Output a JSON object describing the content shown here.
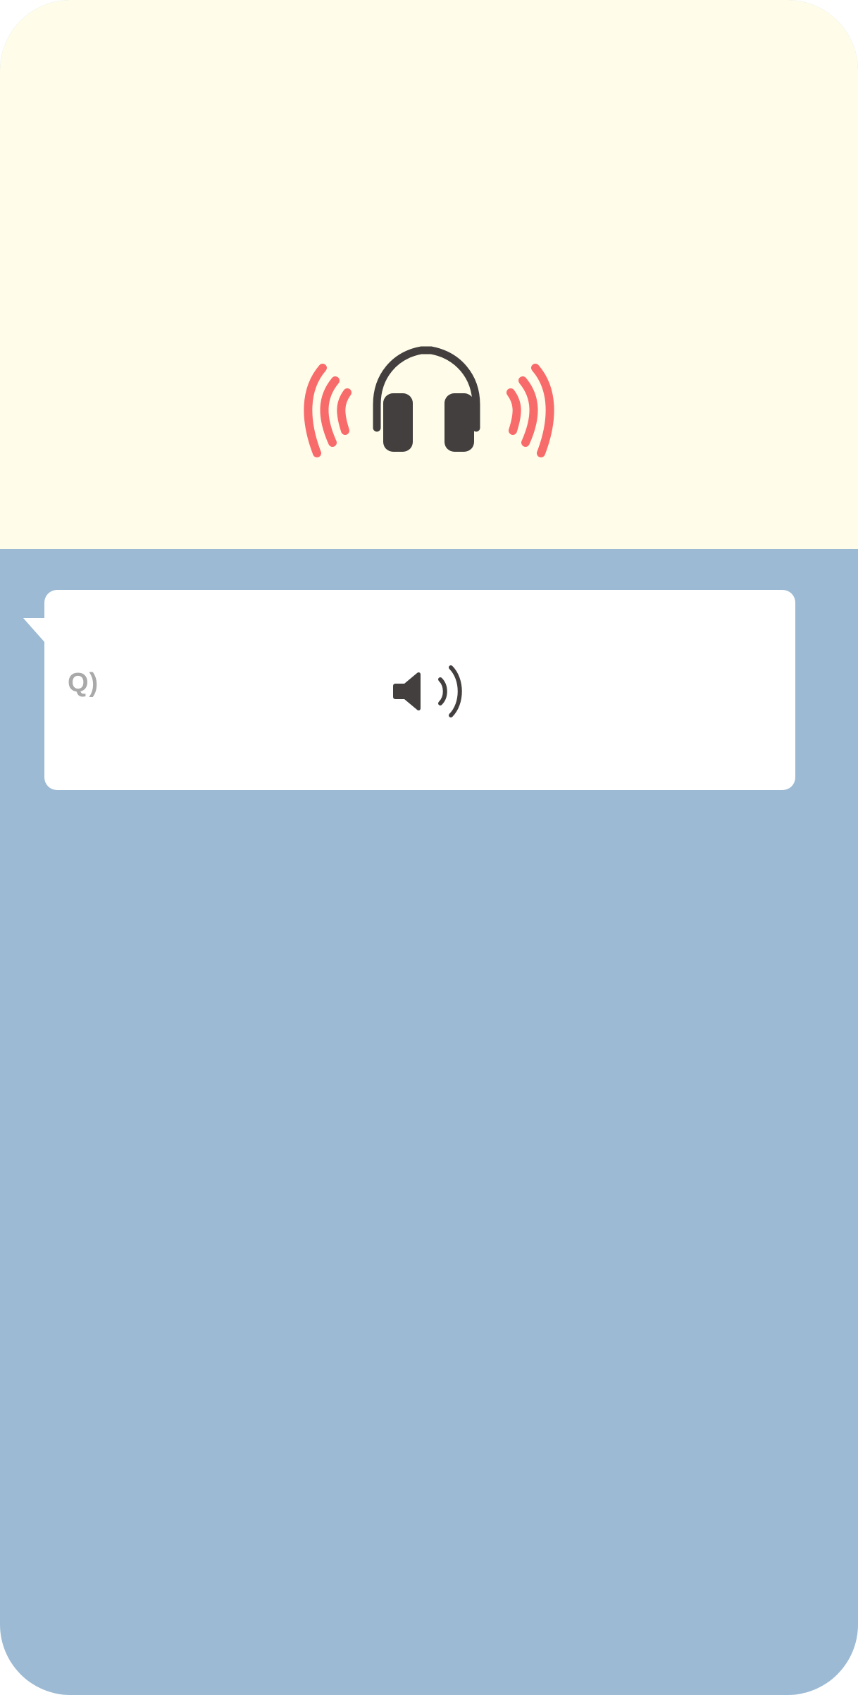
{
  "question": {
    "label": "Q)"
  },
  "icons": {
    "hero": "headphones-sound-icon",
    "audio": "speaker-icon"
  },
  "colors": {
    "top_background": "#fffde9",
    "bottom_background": "#9cbad4",
    "card_background": "#ffffff",
    "wave_accent": "#f86b6b",
    "icon_dark": "#433f3f",
    "label_gray": "#a9a9a9"
  }
}
